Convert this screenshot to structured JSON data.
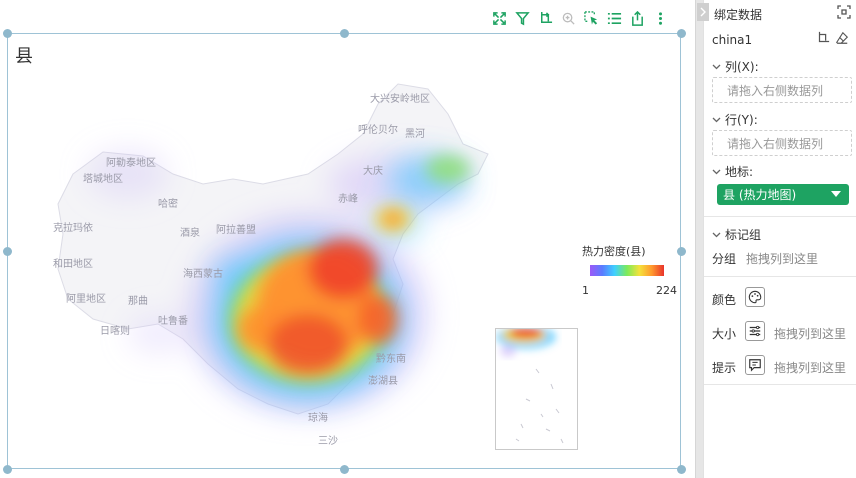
{
  "chart": {
    "title": "县",
    "legend_title": "热力密度(县)",
    "legend_min": "1",
    "legend_max": "224",
    "gradient_colors": [
      "#9b59f7",
      "#5a7cff",
      "#3fd0ff",
      "#7dea5a",
      "#f4e23c",
      "#ff9a2e",
      "#e8342b"
    ]
  },
  "toolbar": {
    "icons": [
      "fullscreen-icon",
      "filter-icon",
      "drill-icon",
      "zoom-icon",
      "select-icon",
      "list-icon",
      "export-icon",
      "more-icon"
    ]
  },
  "map_labels": [
    "大兴安岭地区",
    "呼伦贝尔",
    "阿勒泰地区",
    "塔城地区",
    "哈密",
    "克拉玛依",
    "酒泉",
    "阿拉善盟",
    "海西蒙古",
    "和田地区",
    "阿里地区",
    "那曲",
    "日喀则",
    "黔东南",
    "琼海",
    "三沙",
    "黑河",
    "大庆",
    "赤峰",
    "澎湖县",
    "吐鲁番"
  ],
  "panel": {
    "title": "绑定数据",
    "dataset": "china1",
    "column_label": "列(X):",
    "column_placeholder": "请拖入右侧数据列",
    "row_label": "行(Y):",
    "row_placeholder": "请拖入右侧数据列",
    "geo_label": "地标:",
    "geo_value": "县 (热力地图)",
    "mark_group": "标记组",
    "group_label": "分组",
    "group_hint": "拖拽列到这里",
    "color_label": "颜色",
    "size_label": "大小",
    "size_hint": "拖拽列到这里",
    "tooltip_label": "提示",
    "tooltip_hint": "拖拽列到这里"
  },
  "colors": {
    "accent_green": "#1ea362",
    "frame_blue": "#9ec3d6"
  }
}
